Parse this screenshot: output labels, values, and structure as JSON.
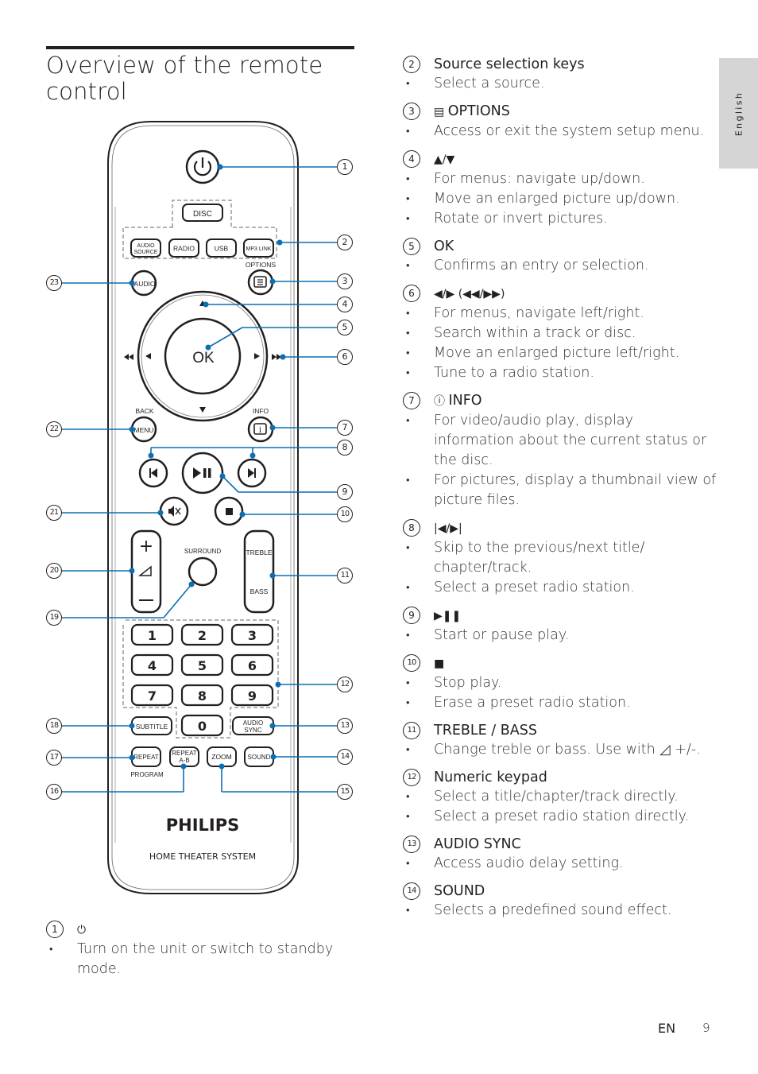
{
  "page": {
    "title": "Overview of the remote control",
    "language_tab": "English",
    "footer_lang": "EN",
    "page_number": "9",
    "accent_color": "#0b6fb3"
  },
  "remote": {
    "brand": "PHILIPS",
    "model": "HOME THEATER SYSTEM",
    "buttons": {
      "disc": "DISC",
      "audio_source_1": "AUDIO",
      "audio_source_2": "SOURCE",
      "radio": "RADIO",
      "usb": "USB",
      "mp3_link": "MP3 LINK",
      "options": "OPTIONS",
      "audio": "AUDIO",
      "ok": "OK",
      "back": "BACK",
      "menu": "MENU",
      "info": "INFO",
      "surround": "SURROUND",
      "treble": "TREBLE",
      "bass": "BASS",
      "subtitle": "SUBTITLE",
      "audio_sync_1": "AUDIO",
      "audio_sync_2": "SYNC",
      "repeat": "REPEAT",
      "program": "PROGRAM",
      "repeat_ab_1": "REPEAT",
      "repeat_ab_2": "A-B",
      "zoom": "ZOOM",
      "sound": "SOUND",
      "keypad": [
        "1",
        "2",
        "3",
        "4",
        "5",
        "6",
        "7",
        "8",
        "9",
        "0"
      ]
    },
    "callouts_right": [
      "1",
      "2",
      "3",
      "4",
      "5",
      "6",
      "7",
      "8",
      "9",
      "10",
      "11",
      "12",
      "13",
      "14",
      "15"
    ],
    "callouts_left": [
      "23",
      "22",
      "21",
      "20",
      "19",
      "18",
      "17",
      "16"
    ]
  },
  "items": [
    {
      "num": "1",
      "symbol": "⏻",
      "label": "",
      "bullets": [
        "Turn on the unit or switch to standby mode."
      ]
    },
    {
      "num": "2",
      "symbol": "",
      "label": "Source selection keys",
      "bullets": [
        "Select a source."
      ]
    },
    {
      "num": "3",
      "symbol": "▤",
      "label": "OPTIONS",
      "bullets": [
        "Access or exit the system setup menu."
      ]
    },
    {
      "num": "4",
      "symbol": "▲/▼",
      "label": "",
      "bullets": [
        "For menus: navigate up/down.",
        "Move an enlarged picture up/down.",
        "Rotate or invert pictures."
      ]
    },
    {
      "num": "5",
      "symbol": "",
      "label": "OK",
      "bullets": [
        "Confirms an entry or selection."
      ]
    },
    {
      "num": "6",
      "symbol": "◀/▶ (◀◀/▶▶)",
      "label": "",
      "bullets": [
        "For menus, navigate left/right.",
        "Search within a track or disc.",
        "Move an enlarged picture left/right.",
        "Tune to a radio station."
      ]
    },
    {
      "num": "7",
      "symbol": "ⓘ",
      "label": "INFO",
      "bullets": [
        "For video/audio play, display information about the current status or the disc.",
        "For pictures, display a thumbnail view of picture files."
      ]
    },
    {
      "num": "8",
      "symbol": "|◀/▶|",
      "label": "",
      "bullets": [
        "Skip to the previous/next title/ chapter/track.",
        "Select a preset radio station."
      ]
    },
    {
      "num": "9",
      "symbol": "▶❚❚",
      "label": "",
      "bullets": [
        "Start or pause play."
      ]
    },
    {
      "num": "10",
      "symbol": "■",
      "label": "",
      "bullets": [
        "Stop play.",
        "Erase a preset radio station."
      ]
    },
    {
      "num": "11",
      "symbol": "",
      "label": "TREBLE / BASS",
      "bullets": [
        "Change treble or bass. Use with ◿ +/-."
      ]
    },
    {
      "num": "12",
      "symbol": "",
      "label": "Numeric keypad",
      "bullets": [
        "Select a title/chapter/track directly.",
        "Select a preset radio station directly."
      ]
    },
    {
      "num": "13",
      "symbol": "",
      "label": "AUDIO SYNC",
      "bullets": [
        "Access audio delay setting."
      ]
    },
    {
      "num": "14",
      "symbol": "",
      "label": "SOUND",
      "bullets": [
        "Selects a predefined sound effect."
      ]
    }
  ]
}
